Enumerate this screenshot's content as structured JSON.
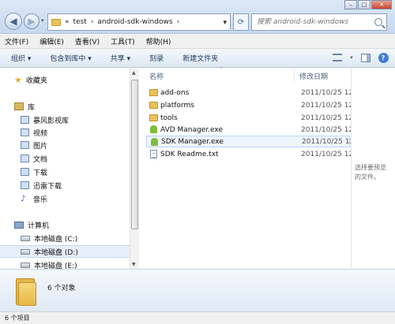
{
  "address": {
    "overflow": "«",
    "crumbs": [
      "test",
      "android-sdk-windows"
    ]
  },
  "search": {
    "placeholder": "搜索 android-sdk-windows"
  },
  "menu": [
    "文件(F)",
    "编辑(E)",
    "查看(V)",
    "工具(T)",
    "帮助(H)"
  ],
  "toolbar": {
    "organize": "组织 ▾",
    "include": "包含到库中 ▾",
    "share": "共享 ▾",
    "burn": "刻录",
    "new_folder": "新建文件夹"
  },
  "nav": {
    "favorites": "收藏夹",
    "libraries": "库",
    "library_items": [
      "暴风影视库",
      "视频",
      "图片",
      "文档",
      "下载",
      "迅雷下载",
      "音乐"
    ],
    "computer": "计算机",
    "drives": [
      "本地磁盘 (C:)",
      "本地磁盘 (D:)",
      "本地磁盘 (E:)"
    ]
  },
  "columns": {
    "name": "名称",
    "date": "修改日期"
  },
  "files": [
    {
      "name": "add-ons",
      "date": "2011/10/25 12",
      "type": "folder"
    },
    {
      "name": "platforms",
      "date": "2011/10/25 12",
      "type": "folder"
    },
    {
      "name": "tools",
      "date": "2011/10/25 12",
      "type": "folder"
    },
    {
      "name": "AVD Manager.exe",
      "date": "2011/10/25 12",
      "type": "exe"
    },
    {
      "name": "SDK Manager.exe",
      "date": "2011/10/25 12",
      "type": "exe"
    },
    {
      "name": "SDK Readme.txt",
      "date": "2011/10/25 12",
      "type": "txt"
    }
  ],
  "preview": {
    "line1": "选择要预览",
    "line2": "的文件。"
  },
  "details": {
    "count": "6 个对象"
  },
  "status": {
    "text": "6 个项目"
  },
  "colors": {
    "accent": "#3d7ed8",
    "folder": "#e9c25a"
  }
}
